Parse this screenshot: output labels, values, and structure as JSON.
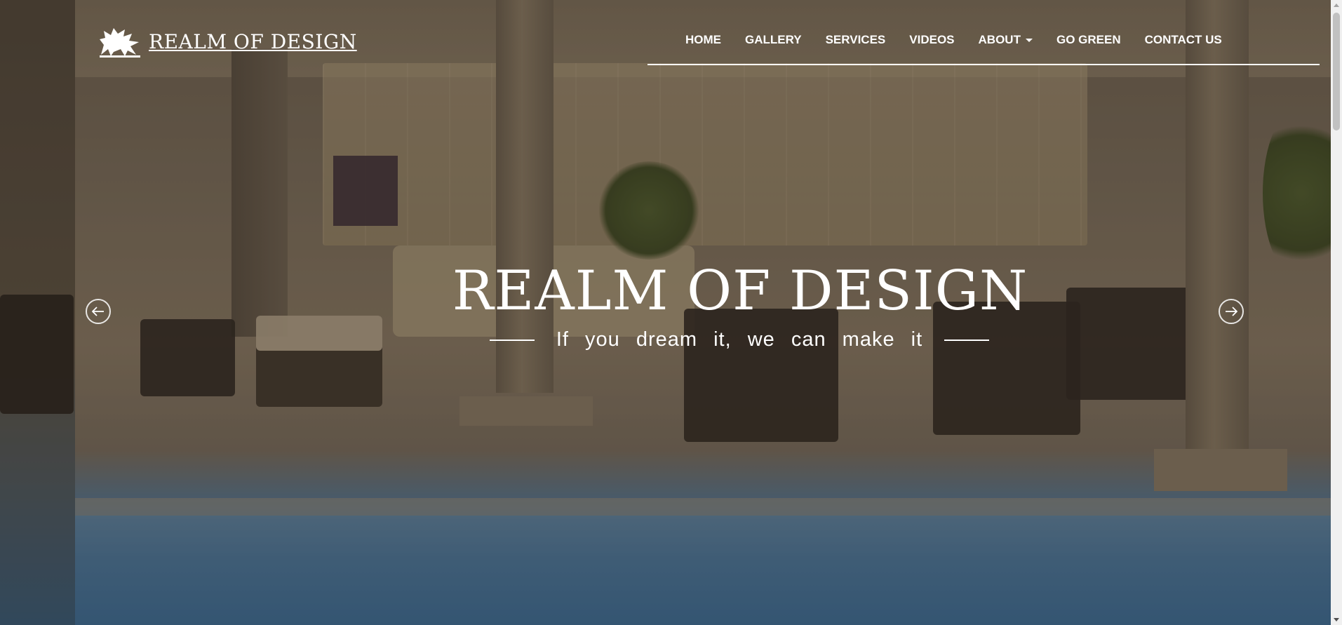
{
  "brand": {
    "name": "REALM OF DESIGN",
    "logo_icon": "griffin-logo-icon"
  },
  "nav": {
    "items": [
      {
        "label": "HOME"
      },
      {
        "label": "GALLERY"
      },
      {
        "label": "SERVICES"
      },
      {
        "label": "VIDEOS"
      },
      {
        "label": "ABOUT",
        "dropdown": true
      },
      {
        "label": "GO GREEN"
      },
      {
        "label": "CONTACT US"
      }
    ]
  },
  "hero": {
    "title": "REALM OF DESIGN",
    "subtitle": "If you dream it, we can make it",
    "prev_icon": "arrow-left-circle-icon",
    "next_icon": "arrow-right-circle-icon"
  },
  "colors": {
    "text": "#ffffff",
    "overlay": "#2a2016",
    "pool": "#3a6f9e",
    "scrollbar_thumb": "#c1c1c1"
  }
}
